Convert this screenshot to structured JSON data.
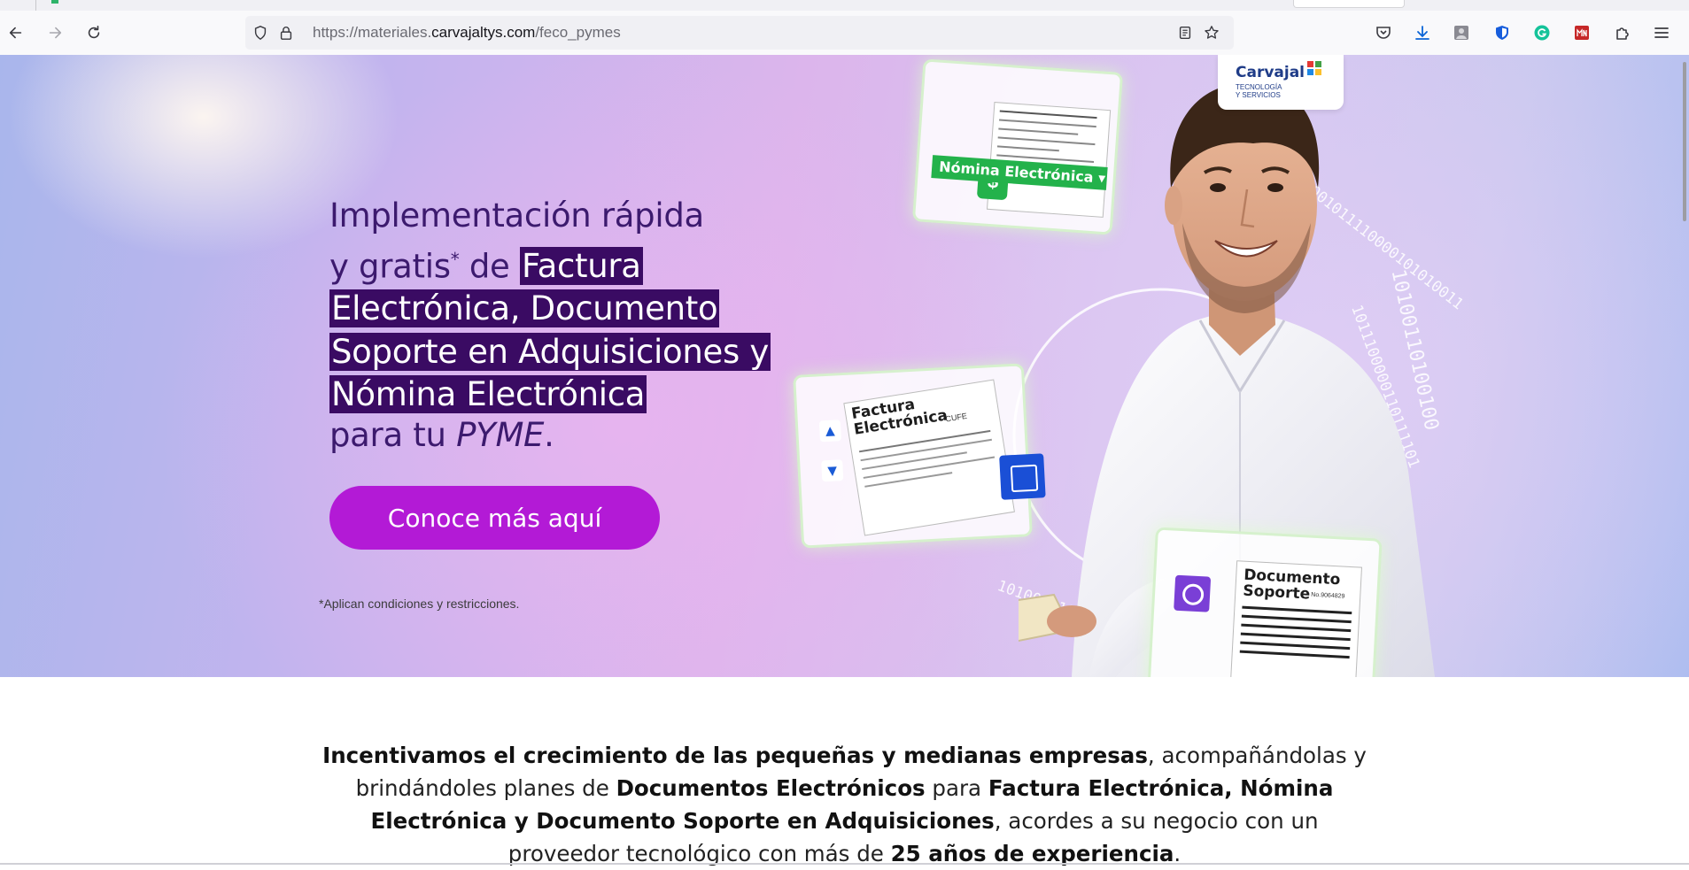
{
  "browser": {
    "url_prefix": "https://materiales.",
    "url_domain": "carvajaltys.com",
    "url_path": "/feco_pymes"
  },
  "hero": {
    "headline_line1": "Implementación rápida",
    "headline_line2_plain": "y gratis",
    "headline_sup": "*",
    "headline_de": " de ",
    "highlight_1": "Factura",
    "highlight_2": "Electrónica, Documento",
    "highlight_3": "Soporte en Adquisiciones y",
    "highlight_4": "Nómina Electrónica",
    "headline_tail": "para tu ",
    "headline_pyme": "PYME",
    "headline_period": ".",
    "cta_label": "Conoce más aquí",
    "disclaimer": "*Aplican condiciones y restricciones."
  },
  "logo": {
    "name": "Carvajal",
    "subtitle_1": "TECNOLOGÍA",
    "subtitle_2": "Y SERVICIOS"
  },
  "illustration": {
    "card_nomina": "Nómina Electrónica",
    "card_factura_1": "Factura",
    "card_factura_2": "Electrónica",
    "card_cufe": "CUFE",
    "card_documento_1": "Documento",
    "card_documento_2": "Soporte",
    "card_doc_number": "No.9064829",
    "binary_1": "1010011001011110000101010011",
    "binary_2": "10100110100100",
    "binary_3": "1011100000110111101",
    "binary_4": "101001110101"
  },
  "intro": {
    "b1": "Incentivamos el crecimiento de las pequeñas y medianas empresas",
    "t1": ", acompañándolas y brindándoles planes de ",
    "b2": "Documentos Electrónicos",
    "t2": " para ",
    "b3": "Factura Electrónica, Nómina Electrónica y Documento Soporte en Adquisiciones",
    "t3": ", acordes a su negocio con un proveedor tecnológico con más de ",
    "b4": "25 años de experiencia",
    "t4": "."
  },
  "colors": {
    "brand_purple": "#3a0b63",
    "cta": "#b31ad6",
    "logo_blue": "#1f3c88",
    "green": "#23b24b"
  },
  "icons": [
    "back-arrow-icon",
    "forward-arrow-icon",
    "reload-icon",
    "shield-icon",
    "lock-icon",
    "reader-view-icon",
    "bookmark-star-icon",
    "pocket-icon",
    "download-icon",
    "profile-icon",
    "bitwarden-icon",
    "grammarly-icon",
    "extension-red-icon",
    "extensions-puzzle-icon",
    "menu-icon"
  ]
}
